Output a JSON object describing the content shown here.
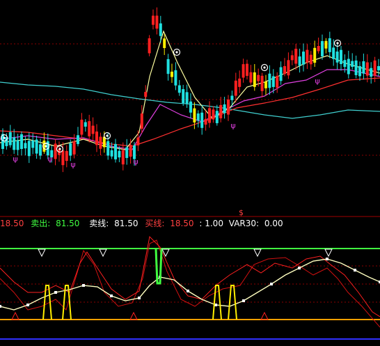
{
  "colors": {
    "background": "#000000",
    "bull": "#ff2020",
    "bear": "#20e0e0",
    "highlight": "#ffee00",
    "ma_short": "#ffffa0",
    "ma_mid": "#e040e0",
    "ma_long": "#ff3030",
    "ma_xlong": "#40d0d0",
    "grid": "#8b0000",
    "sig_green": "#40ff40",
    "sig_orange": "#ffa000",
    "sig_blue": "#3030ff"
  },
  "info_bar": {
    "buy_tail": "18.50",
    "sell_label": "卖出:",
    "sell_value": "81.50",
    "sell_line_label": "卖线:",
    "sell_line_value": "81.50",
    "buy_line_label": "买线:",
    "buy_line_value": "18.50",
    "ratio_text": ": 1.00",
    "var_label": "VAR30:",
    "var_value": "0.00"
  },
  "panel_marker": "$",
  "glyphs": {
    "psi": "ψ"
  }
}
